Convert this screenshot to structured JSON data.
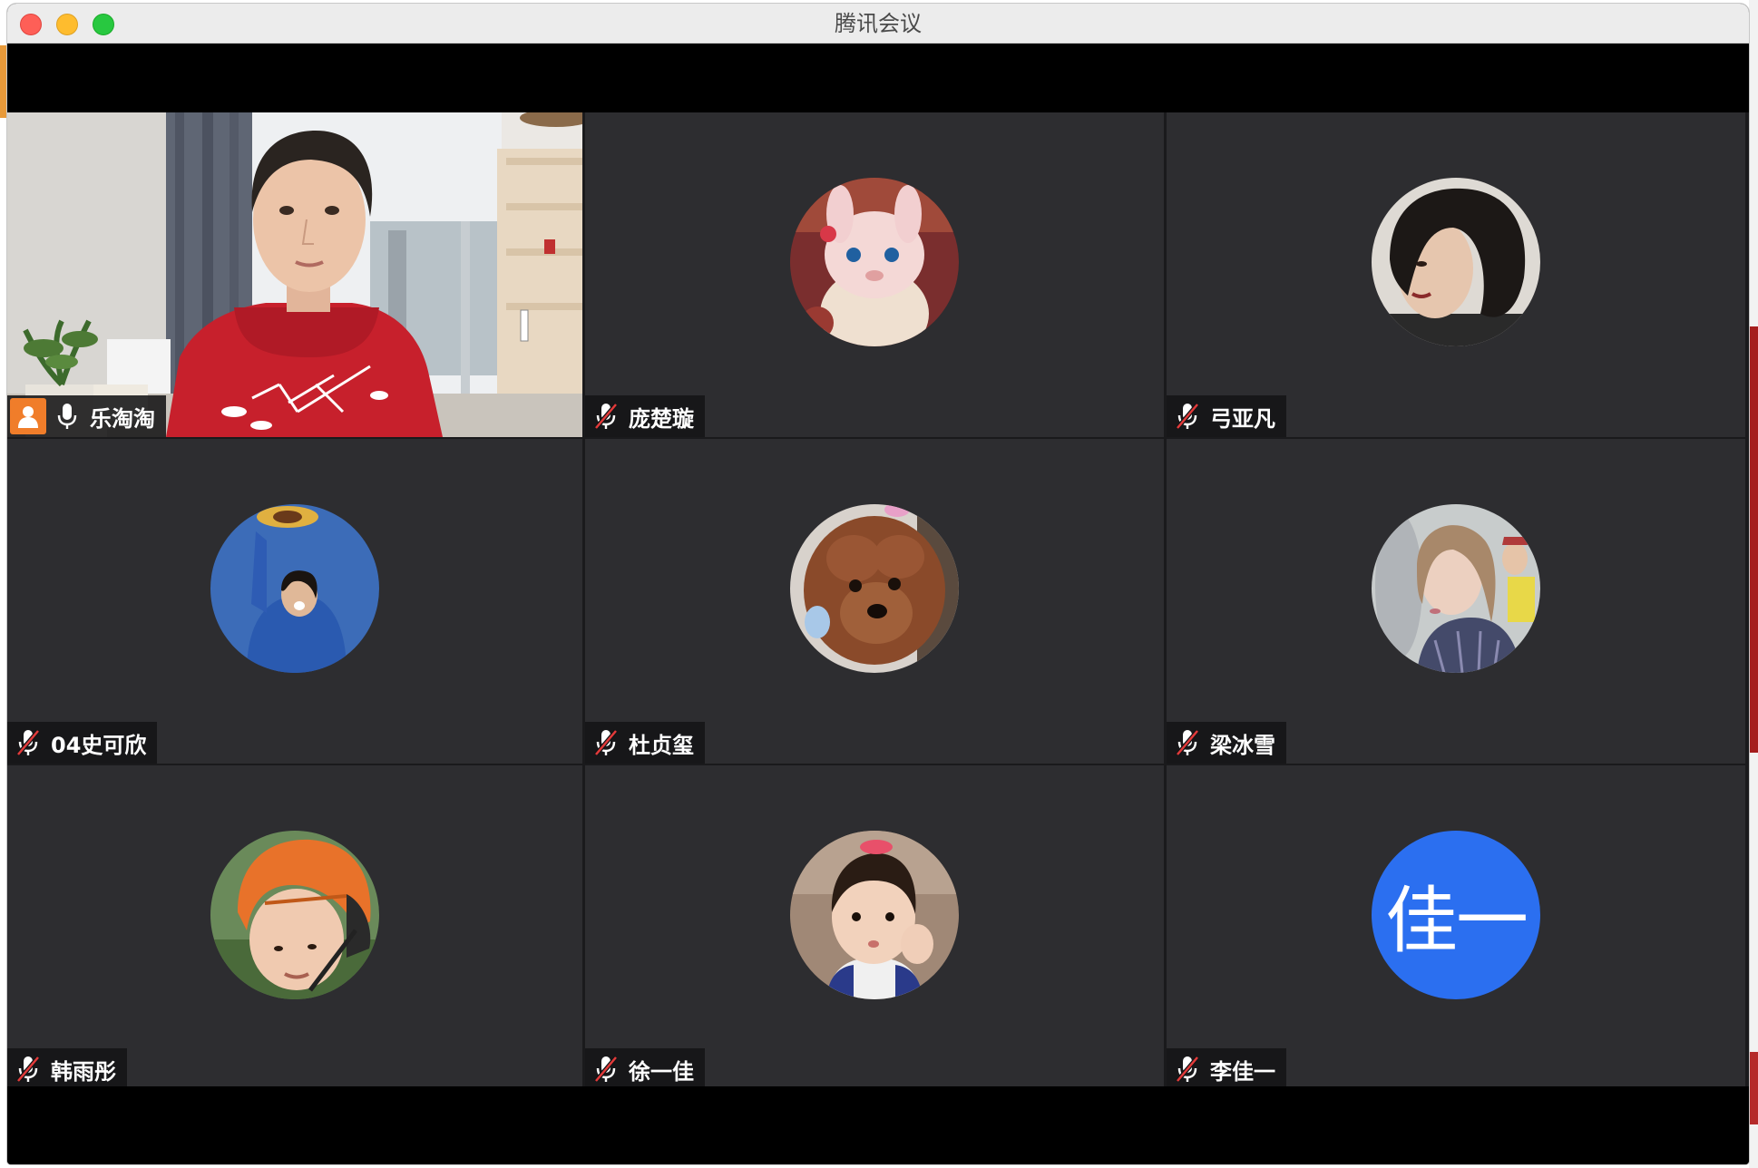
{
  "window": {
    "title": "腾讯会议"
  },
  "participants": [
    {
      "name": "乐淘淘",
      "mic": "on",
      "video": true,
      "host": true
    },
    {
      "name": "庞楚璇",
      "mic": "muted",
      "avatar": "plush-bunny"
    },
    {
      "name": "弓亚凡",
      "mic": "muted",
      "avatar": "girl-portrait"
    },
    {
      "name": "04史可欣",
      "mic": "muted",
      "avatar": "girl-with-hat"
    },
    {
      "name": "杜贞玺",
      "mic": "muted",
      "avatar": "poodle"
    },
    {
      "name": "梁冰雪",
      "mic": "muted",
      "avatar": "girl-crowd"
    },
    {
      "name": "韩雨彤",
      "mic": "muted",
      "avatar": "boy-helmet"
    },
    {
      "name": "徐一佳",
      "mic": "muted",
      "avatar": "little-girl"
    },
    {
      "name": "李佳一",
      "mic": "muted",
      "avatar_text": "佳一",
      "avatar_color": "#2b6ff0"
    }
  ],
  "colors": {
    "tile_bg": "#2d2d30",
    "nametag_bg": "#141416",
    "host_badge": "#f07d2a",
    "text_avatar_bg": "#2b6ff0"
  }
}
